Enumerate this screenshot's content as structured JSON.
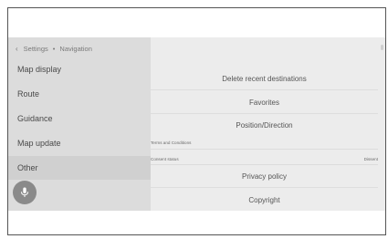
{
  "breadcrumb": {
    "back_icon": "chevron-left-icon",
    "parent": "Settings",
    "separator": "•",
    "current": "Navigation"
  },
  "sidebar": {
    "items": [
      {
        "label": "Map display",
        "active": false
      },
      {
        "label": "Route",
        "active": false
      },
      {
        "label": "Guidance",
        "active": false
      },
      {
        "label": "Map update",
        "active": false
      },
      {
        "label": "Other",
        "active": true
      }
    ],
    "voice_button_icon": "microphone-icon"
  },
  "panel": {
    "delete_recent": "Delete recent destinations",
    "favorites": "Favorites",
    "position_direction": "Position/Direction",
    "terms_label": "Terms and Conditions",
    "consent_label": "Consent status",
    "consent_value": "Dissent",
    "privacy_policy": "Privacy policy",
    "copyright": "Copyright"
  },
  "colors": {
    "sidebar_bg": "#dcdcdc",
    "panel_bg": "#ececec",
    "active_item_bg": "#d0d0d0",
    "mic_button": "#8a8a8a"
  }
}
